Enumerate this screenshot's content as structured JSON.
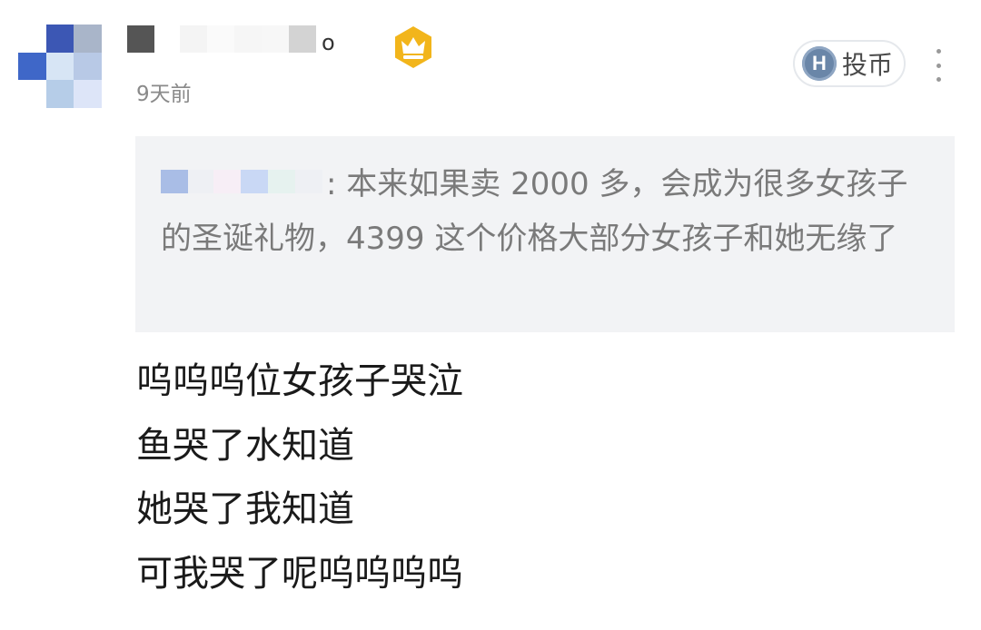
{
  "comment": {
    "author": {
      "name_visible_tail": "o",
      "badge_icon": "crown-icon",
      "badge_color": "#f2b51b"
    },
    "timestamp": "9天前",
    "coin_button": {
      "icon_letter": "H",
      "label": "投币"
    },
    "quote": {
      "separator": ":",
      "text": " 本来如果卖 2000 多，会成为很多女孩子的圣诞礼物，4399 这个价格大部分女孩子和她无缘了"
    },
    "lines": [
      "呜呜呜位女孩子哭泣",
      "鱼哭了水知道",
      "她哭了我知道",
      "可我哭了呢呜呜呜呜"
    ]
  },
  "colors": {
    "quote_background": "#f2f3f5",
    "timestamp": "#8a8a8a",
    "coin_icon": "#6a86a8"
  }
}
